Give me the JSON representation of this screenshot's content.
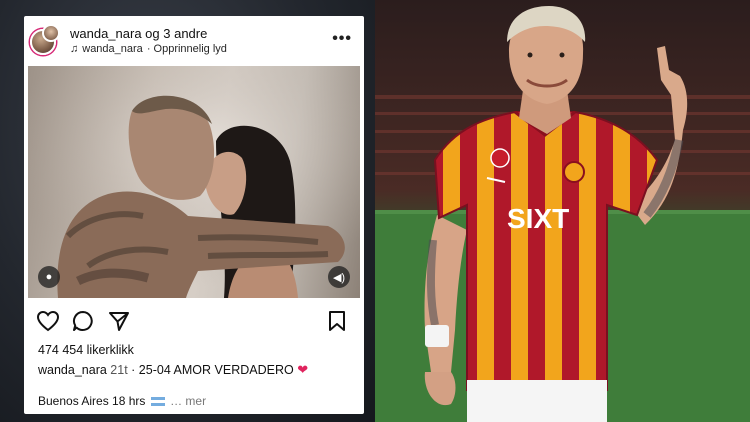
{
  "post": {
    "username_line": "wanda_nara og 3 andre",
    "audio_user": "wanda_nara",
    "audio_label": "· Opprinnelig lyd",
    "more_label": "•••",
    "likes": "474 454 likerklikk",
    "caption_user": "wanda_nara",
    "caption_time": "21t",
    "caption_text": "· 25-04  AMOR VERDADERO",
    "heart": "❤",
    "caption_second": "Buenos Aires 18 hrs",
    "more_link": "… mer",
    "icons": {
      "like": "heart-icon",
      "comment": "comment-icon",
      "share": "send-icon",
      "save": "bookmark-icon",
      "tag": "person-icon",
      "sound": "speaker-icon"
    }
  },
  "photo": {
    "sponsor": "SIXT"
  },
  "colors": {
    "ig_gradient": "#d62976",
    "gala_red": "#b0182a",
    "gala_yellow": "#f2a51c",
    "pitch": "#3e7a3a"
  }
}
